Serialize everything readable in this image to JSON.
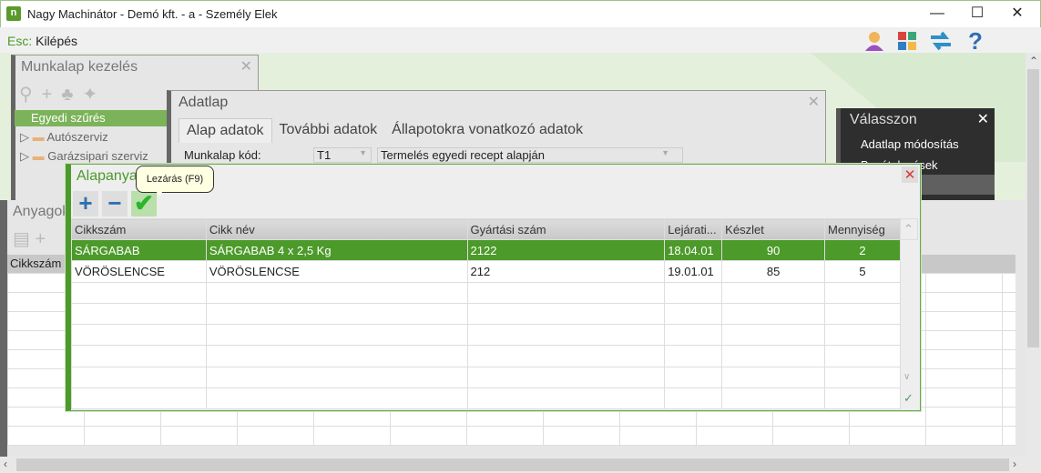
{
  "window": {
    "title": "Nagy Machinátor - Demó kft. - a - Személy Elek",
    "minimize": "—",
    "maximize": "☐",
    "close": "✕"
  },
  "menubar": {
    "esc_key": "Esc:",
    "esc_label": "Kilépés"
  },
  "munkalap": {
    "title": "Munkalap kezelés",
    "close": "✕",
    "tree": [
      "Egyedi szűrés",
      "Autószerviz",
      "Garázsipari szerviz"
    ]
  },
  "adatlap": {
    "title": "Adatlap",
    "close": "✕",
    "tabs": [
      "Alap adatok",
      "További adatok",
      "Állapotokra vonatkozó adatok"
    ],
    "field_label": "Munkalap kód:",
    "code_value": "T1",
    "desc_value": "Termelés egyedi recept alapján"
  },
  "valasszon": {
    "title": "Válasszon",
    "close": "✕",
    "items": [
      "Adatlap módosítás",
      "Bevételezések"
    ]
  },
  "anyag": {
    "title": "Anyagok",
    "col": "Cikkszám"
  },
  "dialog": {
    "title": "Alapanyag",
    "close": "✕",
    "tooltip": "Lezárás (F9)",
    "columns": [
      "Cikkszám",
      "Cikk név",
      "Gyártási szám",
      "Lejárati...",
      "Készlet",
      "Mennyiség"
    ],
    "rows": [
      {
        "cikkszam": "SÁRGABAB",
        "nev": "SÁRGABAB 4 x 2,5 Kg",
        "gyartasi": "2122",
        "lejarat": "18.04.01",
        "keszlet": "90",
        "mennyiseg": "2"
      },
      {
        "cikkszam": "VÖRÖSLENCSE",
        "nev": "VÖRÖSLENCSE",
        "gyartasi": "212",
        "lejarat": "19.01.01",
        "keszlet": "85",
        "mennyiseg": "5"
      }
    ]
  }
}
